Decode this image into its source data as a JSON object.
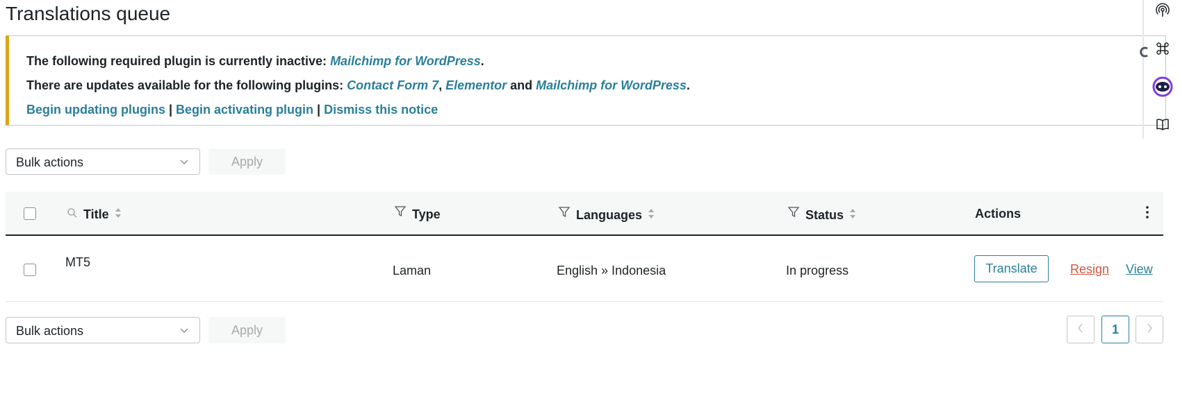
{
  "page": {
    "title": "Translations queue"
  },
  "notice": {
    "line1_text": "The following required plugin is currently inactive: ",
    "line1_link": "Mailchimp for WordPress",
    "line2_text": "There are updates available for the following plugins: ",
    "line2_links": [
      "Contact Form 7",
      "Elementor",
      "Mailchimp for WordPress"
    ],
    "line2_and": " and ",
    "line2_comma": ", ",
    "period": ".",
    "actions": [
      "Begin updating plugins",
      "Begin activating plugin",
      "Dismiss this notice"
    ],
    "separator": " | "
  },
  "bulk_top": {
    "label": "Bulk actions",
    "apply": "Apply"
  },
  "bulk_bottom": {
    "label": "Bulk actions",
    "apply": "Apply"
  },
  "table": {
    "columns": [
      "Title",
      "Type",
      "Languages",
      "Status",
      "Actions"
    ],
    "rows": [
      {
        "title": "MT5",
        "type": "Laman",
        "languages": "English » Indonesia",
        "status": "In progress",
        "actions": {
          "translate": "Translate",
          "resign": "Resign",
          "view": "View"
        }
      }
    ]
  },
  "pagination": {
    "current": "1"
  },
  "colors": {
    "accent": "#2a7f99",
    "warning_border": "#dba617",
    "resign": "#d0563e"
  },
  "icons": [
    "broadcast-icon",
    "command-icon",
    "assistant-face-icon",
    "book-icon",
    "search-icon",
    "filter-icon",
    "sort-icon",
    "more-vertical-icon",
    "chevron-down-icon",
    "chevron-left-icon",
    "chevron-right-icon"
  ]
}
